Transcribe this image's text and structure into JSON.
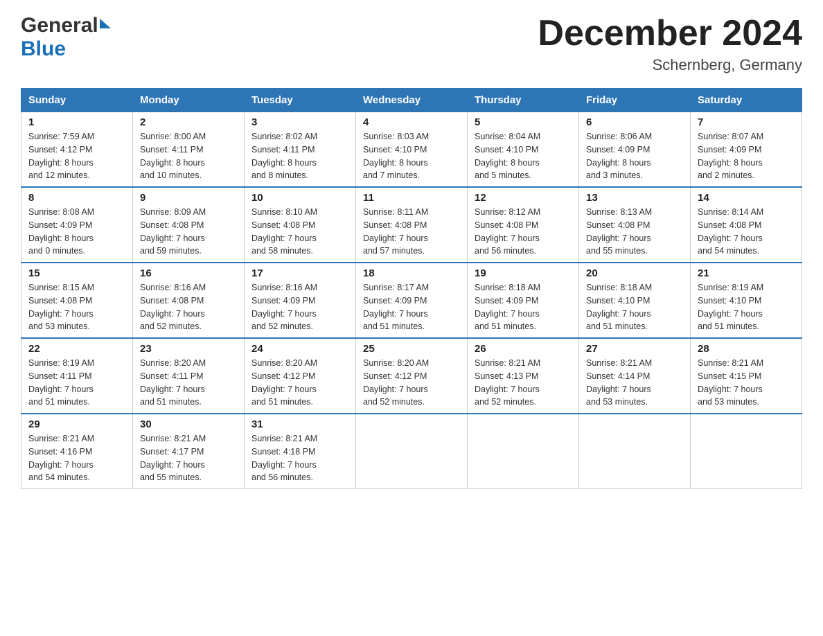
{
  "header": {
    "logo_general": "General",
    "logo_blue": "Blue",
    "title": "December 2024",
    "subtitle": "Schernberg, Germany"
  },
  "calendar": {
    "days_of_week": [
      "Sunday",
      "Monday",
      "Tuesday",
      "Wednesday",
      "Thursday",
      "Friday",
      "Saturday"
    ],
    "weeks": [
      [
        {
          "day": "1",
          "info": "Sunrise: 7:59 AM\nSunset: 4:12 PM\nDaylight: 8 hours\nand 12 minutes."
        },
        {
          "day": "2",
          "info": "Sunrise: 8:00 AM\nSunset: 4:11 PM\nDaylight: 8 hours\nand 10 minutes."
        },
        {
          "day": "3",
          "info": "Sunrise: 8:02 AM\nSunset: 4:11 PM\nDaylight: 8 hours\nand 8 minutes."
        },
        {
          "day": "4",
          "info": "Sunrise: 8:03 AM\nSunset: 4:10 PM\nDaylight: 8 hours\nand 7 minutes."
        },
        {
          "day": "5",
          "info": "Sunrise: 8:04 AM\nSunset: 4:10 PM\nDaylight: 8 hours\nand 5 minutes."
        },
        {
          "day": "6",
          "info": "Sunrise: 8:06 AM\nSunset: 4:09 PM\nDaylight: 8 hours\nand 3 minutes."
        },
        {
          "day": "7",
          "info": "Sunrise: 8:07 AM\nSunset: 4:09 PM\nDaylight: 8 hours\nand 2 minutes."
        }
      ],
      [
        {
          "day": "8",
          "info": "Sunrise: 8:08 AM\nSunset: 4:09 PM\nDaylight: 8 hours\nand 0 minutes."
        },
        {
          "day": "9",
          "info": "Sunrise: 8:09 AM\nSunset: 4:08 PM\nDaylight: 7 hours\nand 59 minutes."
        },
        {
          "day": "10",
          "info": "Sunrise: 8:10 AM\nSunset: 4:08 PM\nDaylight: 7 hours\nand 58 minutes."
        },
        {
          "day": "11",
          "info": "Sunrise: 8:11 AM\nSunset: 4:08 PM\nDaylight: 7 hours\nand 57 minutes."
        },
        {
          "day": "12",
          "info": "Sunrise: 8:12 AM\nSunset: 4:08 PM\nDaylight: 7 hours\nand 56 minutes."
        },
        {
          "day": "13",
          "info": "Sunrise: 8:13 AM\nSunset: 4:08 PM\nDaylight: 7 hours\nand 55 minutes."
        },
        {
          "day": "14",
          "info": "Sunrise: 8:14 AM\nSunset: 4:08 PM\nDaylight: 7 hours\nand 54 minutes."
        }
      ],
      [
        {
          "day": "15",
          "info": "Sunrise: 8:15 AM\nSunset: 4:08 PM\nDaylight: 7 hours\nand 53 minutes."
        },
        {
          "day": "16",
          "info": "Sunrise: 8:16 AM\nSunset: 4:08 PM\nDaylight: 7 hours\nand 52 minutes."
        },
        {
          "day": "17",
          "info": "Sunrise: 8:16 AM\nSunset: 4:09 PM\nDaylight: 7 hours\nand 52 minutes."
        },
        {
          "day": "18",
          "info": "Sunrise: 8:17 AM\nSunset: 4:09 PM\nDaylight: 7 hours\nand 51 minutes."
        },
        {
          "day": "19",
          "info": "Sunrise: 8:18 AM\nSunset: 4:09 PM\nDaylight: 7 hours\nand 51 minutes."
        },
        {
          "day": "20",
          "info": "Sunrise: 8:18 AM\nSunset: 4:10 PM\nDaylight: 7 hours\nand 51 minutes."
        },
        {
          "day": "21",
          "info": "Sunrise: 8:19 AM\nSunset: 4:10 PM\nDaylight: 7 hours\nand 51 minutes."
        }
      ],
      [
        {
          "day": "22",
          "info": "Sunrise: 8:19 AM\nSunset: 4:11 PM\nDaylight: 7 hours\nand 51 minutes."
        },
        {
          "day": "23",
          "info": "Sunrise: 8:20 AM\nSunset: 4:11 PM\nDaylight: 7 hours\nand 51 minutes."
        },
        {
          "day": "24",
          "info": "Sunrise: 8:20 AM\nSunset: 4:12 PM\nDaylight: 7 hours\nand 51 minutes."
        },
        {
          "day": "25",
          "info": "Sunrise: 8:20 AM\nSunset: 4:12 PM\nDaylight: 7 hours\nand 52 minutes."
        },
        {
          "day": "26",
          "info": "Sunrise: 8:21 AM\nSunset: 4:13 PM\nDaylight: 7 hours\nand 52 minutes."
        },
        {
          "day": "27",
          "info": "Sunrise: 8:21 AM\nSunset: 4:14 PM\nDaylight: 7 hours\nand 53 minutes."
        },
        {
          "day": "28",
          "info": "Sunrise: 8:21 AM\nSunset: 4:15 PM\nDaylight: 7 hours\nand 53 minutes."
        }
      ],
      [
        {
          "day": "29",
          "info": "Sunrise: 8:21 AM\nSunset: 4:16 PM\nDaylight: 7 hours\nand 54 minutes."
        },
        {
          "day": "30",
          "info": "Sunrise: 8:21 AM\nSunset: 4:17 PM\nDaylight: 7 hours\nand 55 minutes."
        },
        {
          "day": "31",
          "info": "Sunrise: 8:21 AM\nSunset: 4:18 PM\nDaylight: 7 hours\nand 56 minutes."
        },
        {
          "day": "",
          "info": ""
        },
        {
          "day": "",
          "info": ""
        },
        {
          "day": "",
          "info": ""
        },
        {
          "day": "",
          "info": ""
        }
      ]
    ]
  }
}
